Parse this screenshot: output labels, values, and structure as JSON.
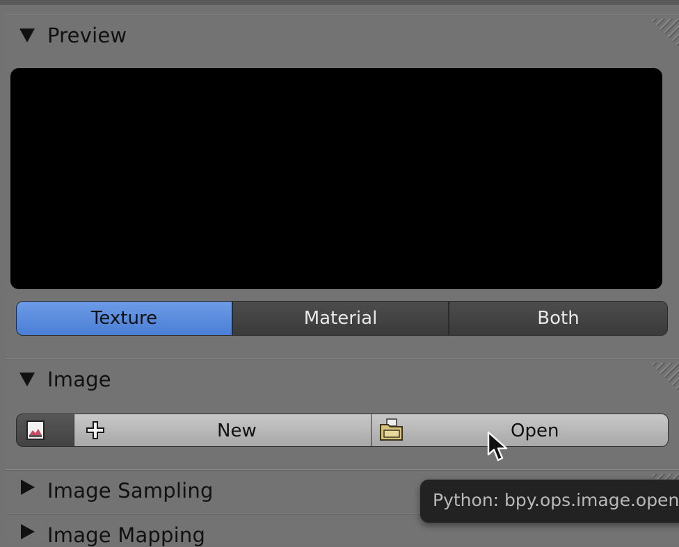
{
  "preview_panel": {
    "title": "Preview",
    "tabs": [
      "Texture",
      "Material",
      "Both"
    ],
    "active_tab": "Texture"
  },
  "image_panel": {
    "title": "Image",
    "new_label": "New",
    "open_label": "Open"
  },
  "collapsed_panels": [
    "Image Sampling",
    "Image Mapping"
  ],
  "tooltip": {
    "text": "Python: bpy.ops.image.open"
  },
  "colors": {
    "active_tab": "#5a8be0",
    "panel_bg": "#737373"
  },
  "icons": [
    "disclosure-triangle-down-icon",
    "disclosure-triangle-right-icon",
    "image-browse-icon",
    "plus-icon",
    "folder-open-icon",
    "mouse-cursor-icon"
  ]
}
